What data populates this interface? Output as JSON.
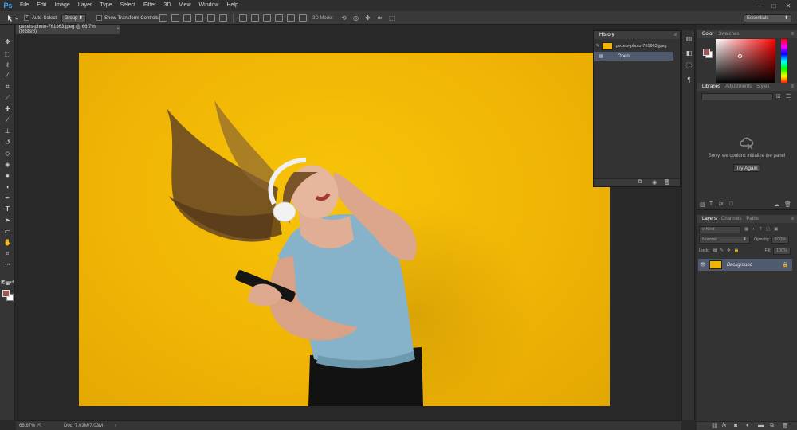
{
  "app": {
    "logo": "Ps",
    "menu": [
      "File",
      "Edit",
      "Image",
      "Layer",
      "Type",
      "Select",
      "Filter",
      "3D",
      "View",
      "Window",
      "Help"
    ]
  },
  "options_bar": {
    "auto_select_label": "Auto-Select:",
    "auto_select_value": "Group",
    "show_transform_label": "Show Transform Controls",
    "mode_3d_label": "3D Mode:",
    "workspace": "Essentials"
  },
  "document": {
    "tab_title": "pexels-photo-761963.jpeg @ 66.7% (RGB/8)",
    "tab_close": "×"
  },
  "status": {
    "zoom": "66.67%",
    "doc_info": "Doc: 7.03M/7.03M"
  },
  "history": {
    "title": "History",
    "snapshot": "pexels-photo-761963.jpeg",
    "steps": [
      "Open"
    ]
  },
  "color_panel": {
    "tabs": [
      "Color",
      "Swatches"
    ],
    "foreground": "#9b5757",
    "background": "#ffffff"
  },
  "libraries_panel": {
    "tabs": [
      "Libraries",
      "Adjustments",
      "Styles"
    ],
    "message": "Sorry, we couldn't initialize the panel",
    "try_again": "Try Again"
  },
  "layers_panel": {
    "tabs": [
      "Layers",
      "Channels",
      "Paths"
    ],
    "filter": "Kind",
    "blend_mode": "Normal",
    "opacity_label": "Opacity:",
    "opacity_value": "100%",
    "lock_label": "Lock:",
    "fill_label": "Fill:",
    "fill_value": "100%",
    "layers": [
      {
        "name": "Background",
        "locked": true,
        "visible": true
      }
    ]
  },
  "colors": {
    "accent_ps": "#31a8ff",
    "canvas_yellow": "#f0b505",
    "selection": "#4f5a6e"
  }
}
